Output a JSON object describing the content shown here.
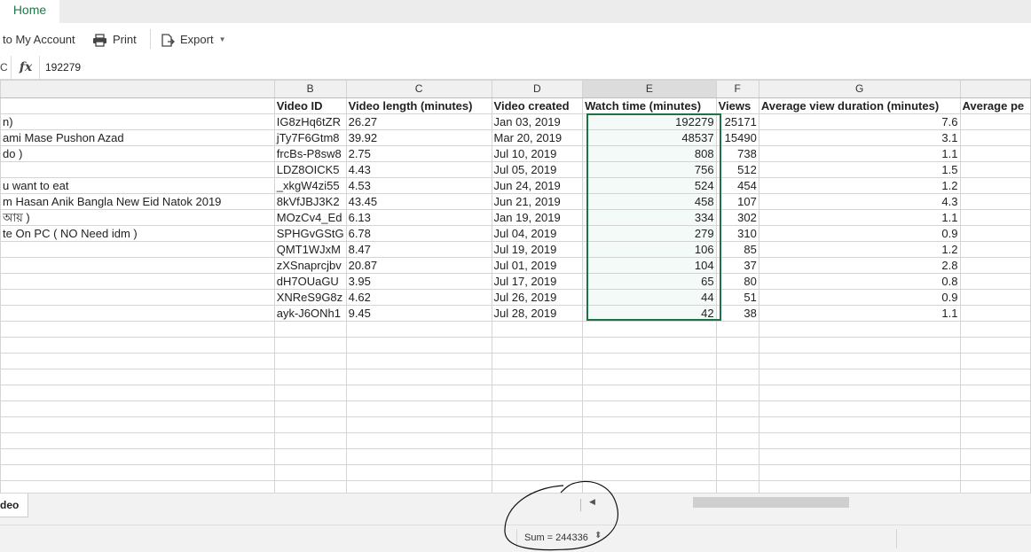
{
  "ribbon": {
    "tab_home": "Home",
    "account_label": "to My Account",
    "print_label": "Print",
    "export_label": "Export"
  },
  "formula": {
    "cell_ref": "C",
    "fx": "fx",
    "value": "192279"
  },
  "columns": [
    {
      "letter": "",
      "header": ""
    },
    {
      "letter": "B",
      "header": "Video ID"
    },
    {
      "letter": "C",
      "header": "Video length (minutes)"
    },
    {
      "letter": "D",
      "header": "Video created"
    },
    {
      "letter": "E",
      "header": "Watch time (minutes)"
    },
    {
      "letter": "F",
      "header": "Views"
    },
    {
      "letter": "G",
      "header": "Average view duration (minutes)"
    },
    {
      "letter": "",
      "header": "Average pe"
    }
  ],
  "rows": [
    [
      "n)",
      "IG8zHq6tZR",
      "26.27",
      "Jan 03, 2019",
      "192279",
      "25171",
      "7.6",
      ""
    ],
    [
      "ami Mase  Pushon Azad",
      "jTy7F6Gtm8",
      "39.92",
      "Mar 20, 2019",
      "48537",
      "15490",
      "3.1",
      ""
    ],
    [
      "do )",
      "frcBs-P8sw8",
      "2.75",
      "Jul 10, 2019",
      "808",
      "738",
      "1.1",
      ""
    ],
    [
      "",
      "LDZ8OICK5",
      "4.43",
      "Jul 05, 2019",
      "756",
      "512",
      "1.5",
      ""
    ],
    [
      "u want to eat",
      "_xkgW4zi55",
      "4.53",
      "Jun 24, 2019",
      "524",
      "454",
      "1.2",
      ""
    ],
    [
      "m Hasan Anik   Bangla New Eid Natok 2019",
      "8kVfJBJ3K2",
      "43.45",
      "Jun 21, 2019",
      "458",
      "107",
      "4.3",
      ""
    ],
    [
      "আয় )",
      "MOzCv4_Ed",
      "6.13",
      "Jan 19, 2019",
      "334",
      "302",
      "1.1",
      ""
    ],
    [
      "te On PC ( NO Need  idm )",
      "SPHGvGStG",
      "6.78",
      "Jul 04, 2019",
      "279",
      "310",
      "0.9",
      ""
    ],
    [
      "",
      "QMT1WJxM",
      "8.47",
      "Jul 19, 2019",
      "106",
      "85",
      "1.2",
      ""
    ],
    [
      "",
      "zXSnaprcjbv",
      "20.87",
      "Jul 01, 2019",
      "104",
      "37",
      "2.8",
      ""
    ],
    [
      "",
      "dH7OUaGU",
      "3.95",
      "Jul 17, 2019",
      "65",
      "80",
      "0.8",
      ""
    ],
    [
      "",
      "XNReS9G8z",
      "4.62",
      "Jul 26, 2019",
      "44",
      "51",
      "0.9",
      ""
    ],
    [
      "",
      "ayk-J6ONh1",
      "9.45",
      "Jul 28, 2019",
      "42",
      "38",
      "1.1",
      ""
    ]
  ],
  "sheet_tab": "deo",
  "status": {
    "sum_label": "Sum = 244336"
  },
  "colors": {
    "accent": "#1f7246",
    "selection_fill": "#f4faf7"
  }
}
